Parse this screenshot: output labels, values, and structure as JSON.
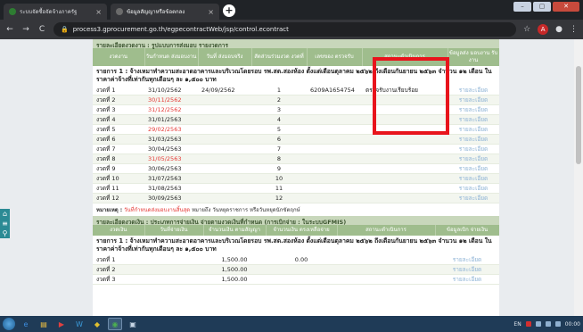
{
  "browser": {
    "tabs": [
      {
        "title": "ระบบจัดซื้อจัดจ้างภาครัฐ",
        "favicon_color": "#2e7d32"
      },
      {
        "title": "ข้อมูลสัญญาหรือข้อตกลง",
        "favicon_color": "#6b6b6b"
      }
    ],
    "url": "process3.gprocurement.go.th/egpecontractWeb/jsp/control.econtract",
    "window_buttons": [
      "–",
      "▢",
      "✕"
    ]
  },
  "section1": {
    "title": "รายละเอียดงวดงาน : รูปแบบการส่งมอบ รายงวดการ",
    "columns": [
      "งวดงาน",
      "วันกำหนด ส่งมอบงาน",
      "วันที่ ส่งมอบจริง",
      "สัดส่วนร่วมงวด งวดที่",
      "เลขของ ตรวจรับ",
      "สถานะดำเนินการ",
      "ข้อมูลส่ง มอบงาน รับงาน"
    ],
    "description": "รายการ 1 : จ้างเหมาทำความสะอาดอาคารและบริเวณโดยรอบ รพ.สต.สองห้อง ตั้งแต่เดือนตุลาคม ๒๕๖๒ ถึงเดือนกันยายน ๒๕๖๓ จำนวน ๑๒ เดือน ในราคาค่าจ้างที่เท่ากันทุกเดือนๆ ละ ๑,๕๐๐ บาท",
    "rows": [
      {
        "period": "งวดที่ 1",
        "due": "31/10/2562",
        "due_red": false,
        "actual": "24/09/2562",
        "no": "1",
        "doc": "6209A1654754",
        "status": "ตรวจรับงานเรียบร้อย",
        "link": "รายละเอียด"
      },
      {
        "period": "งวดที่ 2",
        "due": "30/11/2562",
        "due_red": true,
        "actual": "",
        "no": "2",
        "doc": "",
        "status": "",
        "link": "รายละเอียด"
      },
      {
        "period": "งวดที่ 3",
        "due": "31/12/2562",
        "due_red": true,
        "actual": "",
        "no": "3",
        "doc": "",
        "status": "",
        "link": "รายละเอียด"
      },
      {
        "period": "งวดที่ 4",
        "due": "31/01/2563",
        "due_red": false,
        "actual": "",
        "no": "4",
        "doc": "",
        "status": "",
        "link": "รายละเอียด"
      },
      {
        "period": "งวดที่ 5",
        "due": "29/02/2563",
        "due_red": true,
        "actual": "",
        "no": "5",
        "doc": "",
        "status": "",
        "link": "รายละเอียด"
      },
      {
        "period": "งวดที่ 6",
        "due": "31/03/2563",
        "due_red": false,
        "actual": "",
        "no": "6",
        "doc": "",
        "status": "",
        "link": "รายละเอียด"
      },
      {
        "period": "งวดที่ 7",
        "due": "30/04/2563",
        "due_red": false,
        "actual": "",
        "no": "7",
        "doc": "",
        "status": "",
        "link": "รายละเอียด"
      },
      {
        "period": "งวดที่ 8",
        "due": "31/05/2563",
        "due_red": true,
        "actual": "",
        "no": "8",
        "doc": "",
        "status": "",
        "link": "รายละเอียด"
      },
      {
        "period": "งวดที่ 9",
        "due": "30/06/2563",
        "due_red": false,
        "actual": "",
        "no": "9",
        "doc": "",
        "status": "",
        "link": "รายละเอียด"
      },
      {
        "period": "งวดที่ 10",
        "due": "31/07/2563",
        "due_red": false,
        "actual": "",
        "no": "10",
        "doc": "",
        "status": "",
        "link": "รายละเอียด"
      },
      {
        "period": "งวดที่ 11",
        "due": "31/08/2563",
        "due_red": false,
        "actual": "",
        "no": "11",
        "doc": "",
        "status": "",
        "link": "รายละเอียด"
      },
      {
        "period": "งวดที่ 12",
        "due": "30/09/2563",
        "due_red": false,
        "actual": "",
        "no": "12",
        "doc": "",
        "status": "",
        "link": "รายละเอียด"
      }
    ],
    "note_label": "หมายเหตุ :",
    "note_red": "วันที่กำหนดส่งมอบงานสิ้นสุด",
    "note_rest": "หมายถึง วันหยุดราชการ หรือวันหยุดนักขัตฤกษ์"
  },
  "section2": {
    "title": "รายละเอียดงวดเงิน : ประเภทการจ่ายเงิน จ่ายตามงวดเงินที่กำหนด (การเบิกจ่าย : ในระบบGFMIS)",
    "columns": [
      "งวดเงิน",
      "วันที่จ่ายเงิน",
      "จำนวนเงิน ตามสัญญา",
      "จำนวนเงิน ตรงเหลือจ่าย",
      "สถานะดำเนินการ",
      "ข้อมูลเบิก จ่ายเงิน"
    ],
    "description": "รายการ 1 : จ้างเหมาทำความสะอาดอาคารและบริเวณโดยรอบ รพ.สต.สองห้อง ตั้งแต่เดือนตุลาคม ๒๕๖๒ ถึงเดือนกันยายน ๒๕๖๓ จำนวน ๑๒ เดือน ในราคาค่าจ้างที่เท่ากันทุกเดือนๆ ละ ๑,๕๐๐ บาท",
    "rows": [
      {
        "period": "งวดที่ 1",
        "date": "",
        "amount": "1,500.00",
        "remaining": "0.00",
        "status": "",
        "link": "รายละเอียด"
      },
      {
        "period": "งวดที่ 2",
        "date": "",
        "amount": "1,500.00",
        "remaining": "",
        "status": "",
        "link": "รายละเอียด"
      },
      {
        "period": "งวดที่ 3",
        "date": "",
        "amount": "1,500.00",
        "remaining": "",
        "status": "",
        "link": "รายละเอียด"
      }
    ]
  },
  "fab": {
    "home": "⌂",
    "menu": "≡",
    "search": "⚲"
  },
  "taskbar": {
    "tray_lang": "EN",
    "clock": "00:00"
  }
}
